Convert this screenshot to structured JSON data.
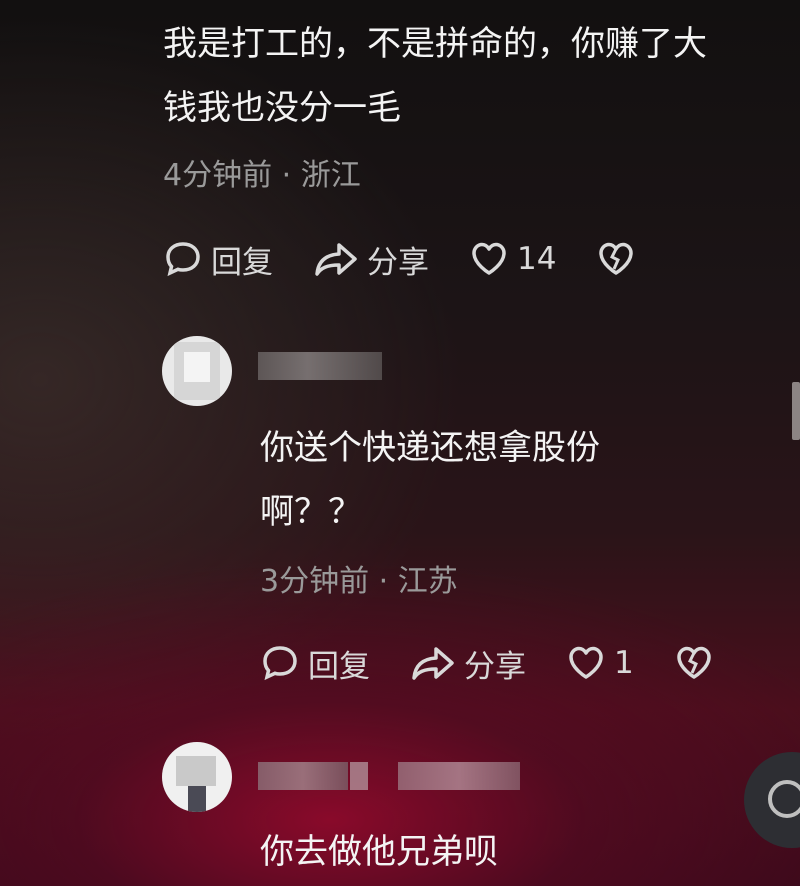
{
  "comments": [
    {
      "text_line1": "我是打工的，不是拼命的，你赚了大",
      "text_line2": "钱我也没分一毛",
      "meta": "4分钟前 · 浙江",
      "reply_label": "回复",
      "share_label": "分享",
      "like_count": "14"
    },
    {
      "text_line1": "你送个快递还想拿股份",
      "text_line2": "啊？？",
      "meta": "3分钟前 · 江苏",
      "reply_label": "回复",
      "share_label": "分享",
      "like_count": "1"
    },
    {
      "text_line1": "你去做他兄弟呗"
    }
  ],
  "icons": {
    "reply": "speech-bubble-icon",
    "share": "share-arrow-icon",
    "like": "heart-icon",
    "dislike": "broken-heart-icon"
  },
  "colors": {
    "text": "#f4f4f4",
    "meta": "#9a9a9a",
    "action": "#d9d9d9",
    "accent_red": "#8a0c28"
  }
}
